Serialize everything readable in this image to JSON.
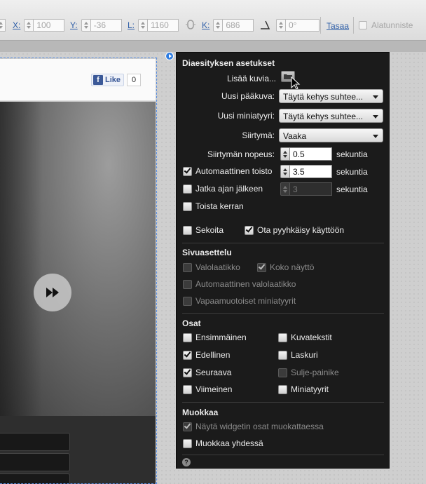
{
  "toolbar": {
    "x_label": "X:",
    "x_value": "100",
    "y_label": "Y:",
    "y_value": "-36",
    "w_label": "L:",
    "w_value": "1160",
    "h_label": "K:",
    "h_value": "686",
    "angle_value": "0°",
    "align_label": "Tasaa",
    "baseline_label": "Alatunniste"
  },
  "facebook": {
    "like_label": "Like",
    "like_count": "0"
  },
  "panel": {
    "title": "Diaesityksen asetukset",
    "add_images_label": "Lisää kuvia...",
    "main_image_label": "Uusi pääkuva:",
    "main_image_value": "Täytä kehys suhtee...",
    "thumbnail_label": "Uusi miniatyyri:",
    "thumbnail_value": "Täytä kehys suhtee...",
    "transition_label": "Siirtymä:",
    "transition_value": "Vaaka",
    "transition_speed_label": "Siirtymän nopeus:",
    "transition_speed_value": "0.5",
    "seconds_1": "sekuntia",
    "autoplay_label": "Automaattinen toisto",
    "autoplay_value": "3.5",
    "seconds_2": "sekuntia",
    "continue_after_label": "Jatka ajan jälkeen",
    "continue_after_value": "3",
    "seconds_3": "sekuntia",
    "play_once_label": "Toista kerran",
    "shuffle_label": "Sekoita",
    "swipe_label": "Ota pyyhkäisy käyttöön",
    "layout_title": "Sivuasettelu",
    "lightbox_label": "Valolaatikko",
    "fullscreen_label": "Koko näyttö",
    "auto_lightbox_label": "Automaattinen valolaatikko",
    "freeform_thumbs_label": "Vapaamuotoiset miniatyyrit",
    "parts_title": "Osat",
    "first_label": "Ensimmäinen",
    "captions_label": "Kuvatekstit",
    "previous_label": "Edellinen",
    "counter_label": "Laskuri",
    "next_label": "Seuraava",
    "close_label": "Sulje-painike",
    "last_label": "Viimeinen",
    "thumbnails_label": "Miniatyyrit",
    "edit_title": "Muokkaa",
    "show_parts_label": "Näytä widgetin osat muokattaessa",
    "edit_together_label": "Muokkaa yhdessä",
    "help_glyph": "?"
  }
}
